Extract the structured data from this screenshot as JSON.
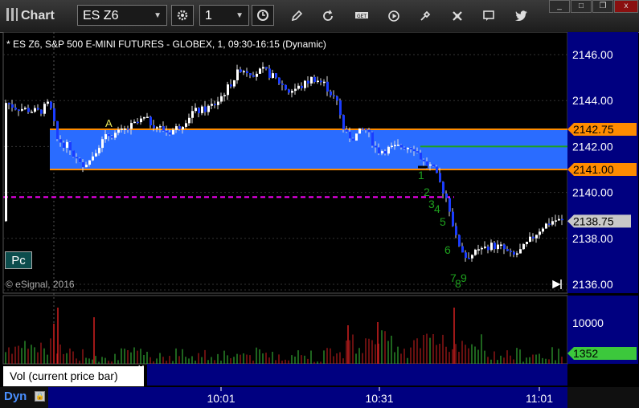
{
  "window": {
    "title": "Chart",
    "minimize": "_",
    "maximize": "□",
    "close": "x"
  },
  "toolbar": {
    "symbol": "ES Z6",
    "interval": "1",
    "icons": [
      "settings-gear-icon",
      "clock-icon",
      "pencil-icon",
      "refresh-icon",
      "get-icon",
      "play-icon",
      "tools-icon",
      "comment-icon",
      "twitter-icon"
    ]
  },
  "chart_header": {
    "description": "* ES Z6, S&P 500 E-MINI FUTURES - GLOBEX, 1, 09:30-16:15 (Dynamic)",
    "copyright": "© eSignal, 2016",
    "badge": "Pc"
  },
  "chart_data": {
    "type": "candlestick",
    "price_axis": {
      "labels": [
        "2146.00",
        "2144.00",
        "2142.00",
        "2140.00",
        "2138.00",
        "2136.00"
      ],
      "ylim": [
        2135.6,
        2146.8
      ]
    },
    "time_axis": {
      "labels": [
        "10:01",
        "10:31",
        "11:01"
      ]
    },
    "levels": [
      {
        "name": "Upper level",
        "value": 2142.75,
        "label": "2142.75",
        "color": "#ff8c00"
      },
      {
        "name": "Lower level",
        "value": 2141.0,
        "label": "2141.00",
        "color": "#ff8c00"
      }
    ],
    "zone": {
      "from": 2141.0,
      "to": 2142.75,
      "color": "#2a6cff"
    },
    "green_line": 2142.0,
    "magenta_line": 2139.8,
    "last_price": {
      "value": 2138.75,
      "label": "2138.75"
    },
    "annotation_A": "A",
    "count_labels": [
      "1",
      "2",
      "3",
      "4",
      "5",
      "6",
      "7",
      "8",
      "9"
    ],
    "volume": {
      "axis_label": "10000",
      "last_label": "1352",
      "study": "Vol (current price bar)"
    }
  },
  "status": {
    "mode": "Dyn"
  }
}
